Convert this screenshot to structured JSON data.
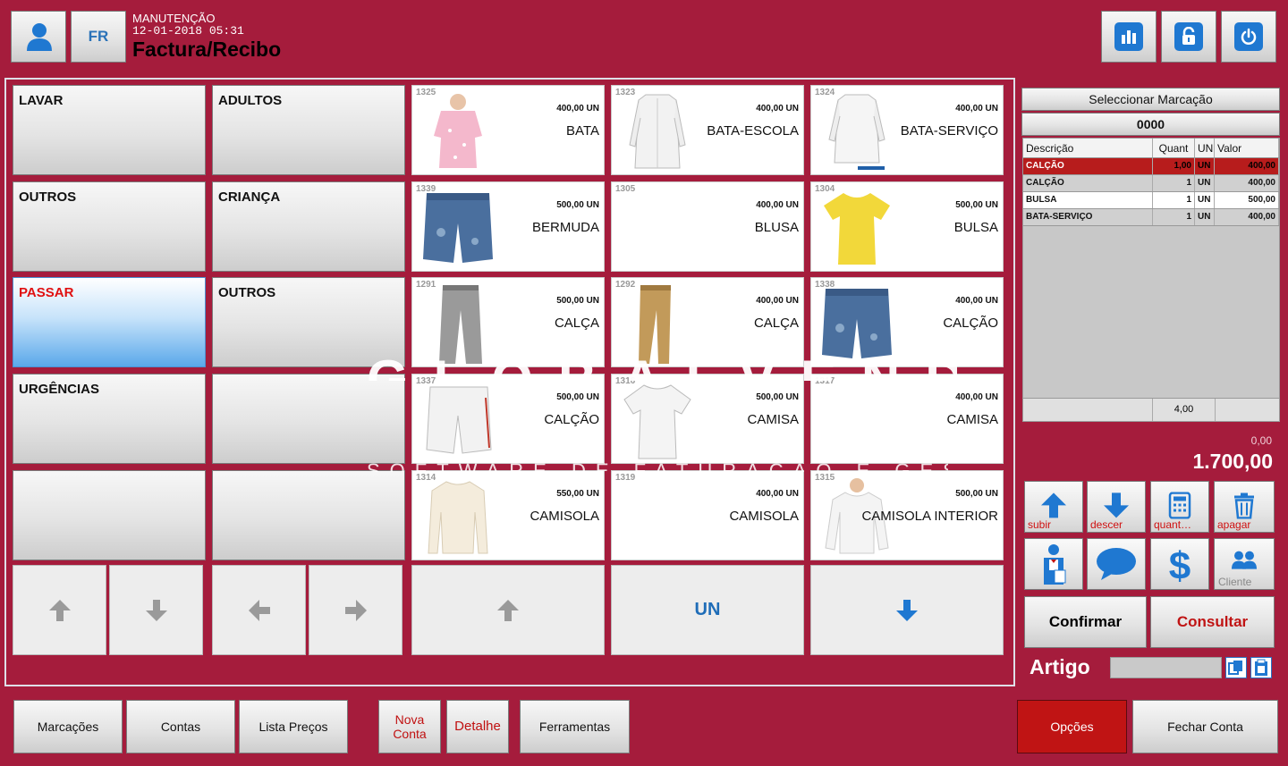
{
  "header": {
    "fr_label": "FR",
    "mode": "MANUTENÇÃO",
    "datetime": "12-01-2018 05:31",
    "document_type": "Factura/Recibo"
  },
  "categories": [
    {
      "label": "LAVAR"
    },
    {
      "label": "ADULTOS"
    },
    {
      "label": "OUTROS"
    },
    {
      "label": "CRIANÇA"
    },
    {
      "label": "PASSAR",
      "active": true
    },
    {
      "label": "OUTROS"
    },
    {
      "label": "URGÊNCIAS"
    },
    {
      "label": ""
    },
    {
      "label": ""
    },
    {
      "label": ""
    }
  ],
  "products": [
    {
      "code": "1325",
      "price": "400,00 UN",
      "name": "BATA",
      "image": "pink-smock"
    },
    {
      "code": "1323",
      "price": "400,00 UN",
      "name": "BATA-ESCOLA",
      "image": "white-coat"
    },
    {
      "code": "1324",
      "price": "400,00 UN",
      "name": "BATA-SERVIÇO",
      "image": "white-coat"
    },
    {
      "code": "1339",
      "price": "500,00 UN",
      "name": "BERMUDA",
      "image": "denim-shorts"
    },
    {
      "code": "1305",
      "price": "400,00 UN",
      "name": "BLUSA",
      "image": ""
    },
    {
      "code": "1304",
      "price": "500,00 UN",
      "name": "BULSA",
      "image": "yellow-tshirt"
    },
    {
      "code": "1291",
      "price": "500,00 UN",
      "name": "CALÇA",
      "image": "grey-trousers"
    },
    {
      "code": "1292",
      "price": "400,00 UN",
      "name": "CALÇA",
      "image": "tan-trousers"
    },
    {
      "code": "1338",
      "price": "400,00 UN",
      "name": "CALÇÃO",
      "image": "denim-shorts"
    },
    {
      "code": "1337",
      "price": "500,00 UN",
      "name": "CALÇÃO",
      "image": "white-shorts"
    },
    {
      "code": "1316",
      "price": "500,00 UN",
      "name": "CAMISA",
      "image": "white-tshirt"
    },
    {
      "code": "1317",
      "price": "400,00 UN",
      "name": "CAMISA",
      "image": ""
    },
    {
      "code": "1314",
      "price": "550,00 UN",
      "name": "CAMISOLA",
      "image": "cream-sweater"
    },
    {
      "code": "1319",
      "price": "400,00 UN",
      "name": "CAMISOLA",
      "image": ""
    },
    {
      "code": "1315",
      "price": "500,00 UN",
      "name": "CAMISOLA INTERIOR",
      "image": "white-longsleeve"
    }
  ],
  "product_nav": {
    "unit_label": "UN"
  },
  "watermark": {
    "line1": "GLOBALVENDAS",
    "line2": "SOFTWARE DE FATURAÇÃO E GESTÃO"
  },
  "right_panel": {
    "select_label": "Seleccionar Marcação",
    "marking_number": "0000",
    "columns": [
      "Descrição",
      "Quant",
      "UN",
      "Valor"
    ],
    "rows": [
      {
        "desc": "CALÇÃO",
        "qty": "1,00",
        "un": "UN",
        "value": "400,00"
      },
      {
        "desc": "CALÇÃO",
        "qty": "1",
        "un": "UN",
        "value": "400,00"
      },
      {
        "desc": "BULSA",
        "qty": "1",
        "un": "UN",
        "value": "500,00"
      },
      {
        "desc": "BATA-SERVIÇO",
        "qty": "1",
        "un": "UN",
        "value": "400,00"
      }
    ],
    "total_qty": "4,00",
    "discount": "0,00",
    "total": "1.700,00"
  },
  "actions": {
    "up_label": "subir",
    "down_label": "descer",
    "qty_label": "quant…",
    "delete_label": "apagar",
    "client_label": "Cliente",
    "confirm_label": "Confirmar",
    "consult_label": "Consultar",
    "artigo_label": "Artigo"
  },
  "footer": {
    "marcacoes": "Marcações",
    "contas": "Contas",
    "lista_precos": "Lista Preços",
    "nova_conta_1": "Nova",
    "nova_conta_2": "Conta",
    "detalhe": "Detalhe",
    "ferramentas": "Ferramentas",
    "opcoes": "Opções",
    "fechar_conta": "Fechar Conta"
  },
  "colors": {
    "background": "#a51c3c",
    "accent_blue": "#1f78d1",
    "selected_row": "#b71c1c",
    "options_button": "#c01414"
  }
}
